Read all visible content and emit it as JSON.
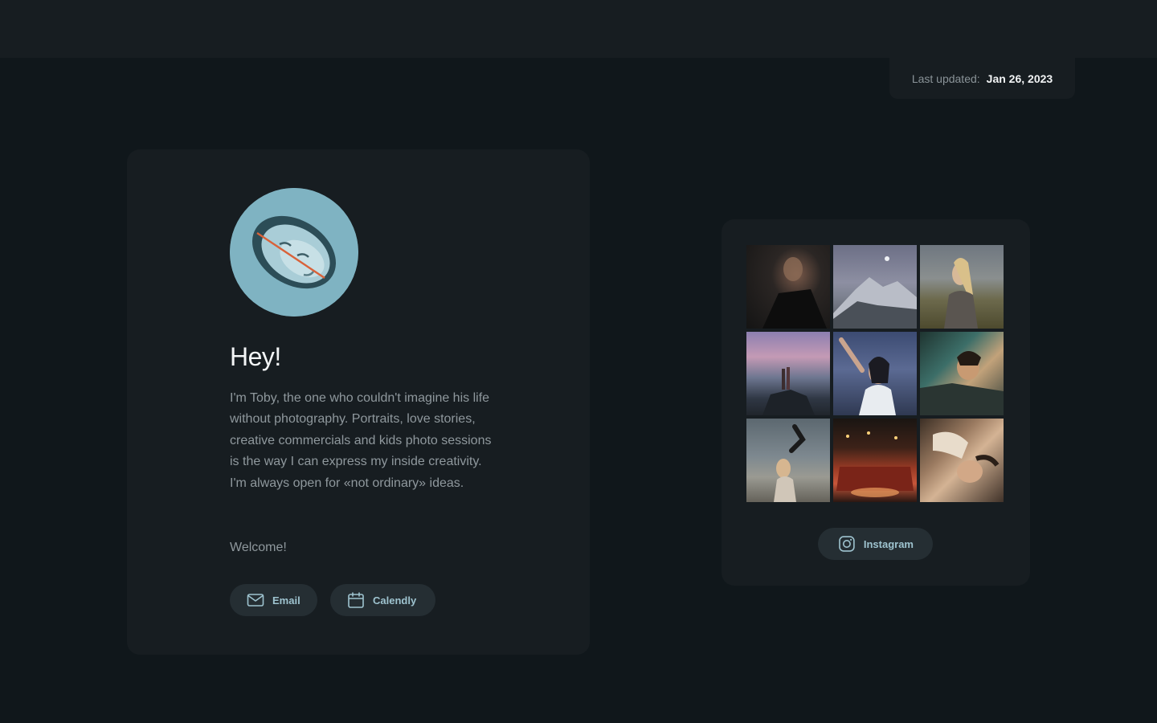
{
  "header": {
    "last_updated_label": "Last updated:",
    "last_updated_value": "Jan 26, 2023"
  },
  "profile": {
    "avatar_icon": "face-portrait",
    "heading": "Hey!",
    "bio": "I'm Toby, the one who couldn't imagine his life without photography. Portraits, love stories, creative commercials and kids photo sessions is the way I can express my inside creativity. I'm always open for «not ordinary» ideas.",
    "welcome": "Welcome!",
    "buttons": {
      "email": {
        "label": "Email",
        "icon": "mail-icon"
      },
      "calendly": {
        "label": "Calendly",
        "icon": "calendar-icon"
      }
    }
  },
  "instagram": {
    "photos": [
      "photo-1",
      "photo-2",
      "photo-3",
      "photo-4",
      "photo-5",
      "photo-6",
      "photo-7",
      "photo-8",
      "photo-9"
    ],
    "button": {
      "label": "Instagram",
      "icon": "instagram-icon"
    }
  },
  "colors": {
    "background": "#10171b",
    "card": "#171d21",
    "button": "#252e33",
    "button_text": "#9ec3cf",
    "heading": "#f3f5f6",
    "body_text": "#8f989d"
  }
}
